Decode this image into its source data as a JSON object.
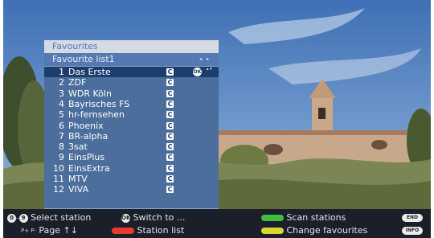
{
  "panel": {
    "title": "Favourites",
    "list_name": "Favourite list1",
    "list_arrows": "◂ ▸",
    "stations": [
      {
        "num": "1",
        "name": "Das Erste",
        "badge": "C"
      },
      {
        "num": "2",
        "name": "ZDF",
        "badge": "C"
      },
      {
        "num": "3",
        "name": "WDR Köln",
        "badge": "C"
      },
      {
        "num": "4",
        "name": "Bayrisches FS",
        "badge": "C"
      },
      {
        "num": "5",
        "name": "hr-fernsehen",
        "badge": "C"
      },
      {
        "num": "6",
        "name": "Phoenix",
        "badge": "C"
      },
      {
        "num": "7",
        "name": "BR-alpha",
        "badge": "C"
      },
      {
        "num": "8",
        "name": "3sat",
        "badge": "C"
      },
      {
        "num": "9",
        "name": "EinsPlus",
        "badge": "C"
      },
      {
        "num": "10",
        "name": "EinsExtra",
        "badge": "C"
      },
      {
        "num": "11",
        "name": "MTV",
        "badge": "C"
      },
      {
        "num": "12",
        "name": "VIVA",
        "badge": "C"
      }
    ],
    "ok_key": "OK",
    "updown": "▴ ▾"
  },
  "help": {
    "select_from": "0",
    "select_to": "9",
    "select_label": "Select station",
    "page_icon": "P+ P-",
    "page_label": "Page ↑↓",
    "ok_key": "OK",
    "switch_label": "Switch to ...",
    "station_list_label": "Station list",
    "scan_label": "Scan stations",
    "change_label": "Change favourites",
    "end_key": "END",
    "info_key": "INFO"
  },
  "colors": {
    "accent": "#1d3d6e",
    "red": "#ea3a2f",
    "green": "#3fbf3f",
    "yellow": "#d7d530"
  }
}
